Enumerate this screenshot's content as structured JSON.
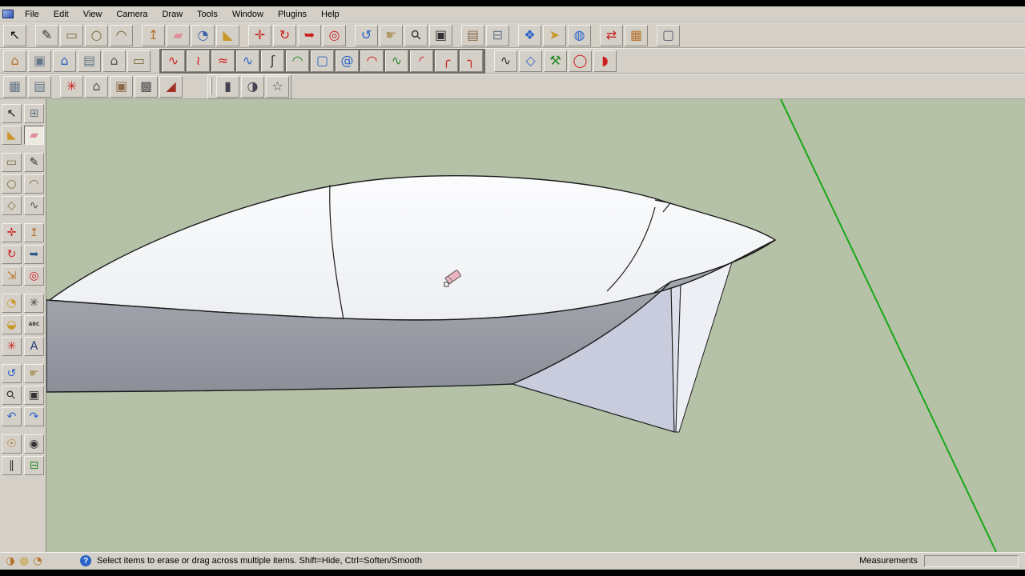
{
  "menu": {
    "items": [
      {
        "label": "File"
      },
      {
        "label": "Edit"
      },
      {
        "label": "View"
      },
      {
        "label": "Camera"
      },
      {
        "label": "Draw"
      },
      {
        "label": "Tools"
      },
      {
        "label": "Window"
      },
      {
        "label": "Plugins"
      },
      {
        "label": "Help"
      }
    ]
  },
  "toolbar_main": {
    "items": [
      {
        "name": "select-tool",
        "glyph": "↖",
        "color": "#111111"
      },
      {
        "name": "line-tool",
        "glyph": "✎",
        "color": "#333333",
        "gap": true
      },
      {
        "name": "rectangle-tool",
        "glyph": "▭",
        "color": "#7a6a3a"
      },
      {
        "name": "circle-tool",
        "glyph": "○",
        "color": "#7a6a3a"
      },
      {
        "name": "arc-tool",
        "glyph": "◠",
        "color": "#7a6a3a"
      },
      {
        "name": "pushpull-tool",
        "glyph": "↥",
        "color": "#b5722a",
        "gap": true
      },
      {
        "name": "eraser-tool",
        "glyph": "▰",
        "color": "#de8f9e"
      },
      {
        "name": "tape-measure-tool",
        "glyph": "◔",
        "color": "#3a62a8"
      },
      {
        "name": "paint-bucket-tool",
        "glyph": "◣",
        "color": "#c8962a"
      },
      {
        "name": "move-tool",
        "glyph": "✛",
        "color": "#cc2020",
        "gap": true
      },
      {
        "name": "rotate-tool",
        "glyph": "↻",
        "color": "#cc2020"
      },
      {
        "name": "follow-me-tool",
        "glyph": "➥",
        "color": "#cc2020"
      },
      {
        "name": "offset-tool",
        "glyph": "◎",
        "color": "#cc2020"
      },
      {
        "name": "orbit-tool",
        "glyph": "↺",
        "color": "#2a62c8",
        "gap": true
      },
      {
        "name": "pan-tool",
        "glyph": "☛",
        "color": "#b09a6a"
      },
      {
        "name": "zoom-tool",
        "glyph": "⚲",
        "color": "#333333",
        "rot": true
      },
      {
        "name": "zoom-window-tool",
        "glyph": "▣",
        "color": "#333333"
      },
      {
        "name": "get-models-tool",
        "glyph": "▤",
        "color": "#8a6a4a",
        "gap": true
      },
      {
        "name": "section-plane-tool",
        "glyph": "⊟",
        "color": "#667788"
      },
      {
        "name": "components-tool",
        "glyph": "❖",
        "color": "#2a62c8",
        "gap": true
      },
      {
        "name": "interact-tool",
        "glyph": "➤",
        "color": "#c8962a"
      },
      {
        "name": "add-location-tool",
        "glyph": "◍",
        "color": "#2a62c8"
      },
      {
        "name": "exchange-tool",
        "glyph": "⇄",
        "color": "#cc2020",
        "gap": true
      },
      {
        "name": "materials-tool",
        "glyph": "▦",
        "color": "#b5722a"
      },
      {
        "name": "box-tool",
        "glyph": "▢",
        "color": "#555566",
        "gap": true
      }
    ]
  },
  "toolbar_views": {
    "items": [
      {
        "name": "iso-view",
        "glyph": "⌂",
        "color": "#b5722a"
      },
      {
        "name": "top-view",
        "glyph": "▣",
        "color": "#667788"
      },
      {
        "name": "home-view",
        "glyph": "⌂",
        "color": "#2a62c8"
      },
      {
        "name": "section-view",
        "glyph": "▤",
        "color": "#667788"
      },
      {
        "name": "front-view",
        "glyph": "⌂",
        "color": "#555555"
      },
      {
        "name": "plan-view",
        "glyph": "▭",
        "color": "#7a6a3a"
      }
    ]
  },
  "toolbar_curves": {
    "items": [
      {
        "name": "bezier-curve",
        "glyph": "∿",
        "color": "#cc2020"
      },
      {
        "name": "bezier-polyline",
        "glyph": "≀",
        "color": "#cc2020"
      },
      {
        "name": "bezier-multi",
        "glyph": "≈",
        "color": "#cc2020"
      },
      {
        "name": "spline",
        "glyph": "∿",
        "color": "#2a62c8"
      },
      {
        "name": "s-curve",
        "glyph": "ʃ",
        "color": "#333333"
      },
      {
        "name": "arc-green",
        "glyph": "◠",
        "color": "#2a8a2a"
      },
      {
        "name": "rounded-rectangle",
        "glyph": "▢",
        "color": "#2a62c8"
      },
      {
        "name": "spiral",
        "glyph": "@",
        "color": "#2a62c8"
      },
      {
        "name": "arc-red",
        "glyph": "◠",
        "color": "#cc2020"
      },
      {
        "name": "curve-green",
        "glyph": "∿",
        "color": "#2a8a2a"
      },
      {
        "name": "quarter-arc",
        "glyph": "◜",
        "color": "#cc2020"
      },
      {
        "name": "corner-arc-left",
        "glyph": "╭",
        "color": "#cc2020"
      },
      {
        "name": "corner-arc-right",
        "glyph": "╮",
        "color": "#cc2020"
      }
    ]
  },
  "toolbar_extra": {
    "items": [
      {
        "name": "curve-n",
        "glyph": "∿",
        "color": "#333333"
      },
      {
        "name": "polygon-tool",
        "glyph": "◇",
        "color": "#2a62c8"
      },
      {
        "name": "wrench-tool",
        "glyph": "⚒",
        "color": "#2a8a2a"
      },
      {
        "name": "ellipse-tool",
        "glyph": "◯",
        "color": "#cc2020"
      },
      {
        "name": "d-shape-tool",
        "glyph": "◗",
        "color": "#cc2020"
      }
    ]
  },
  "toolbar_sandbox": {
    "items": [
      {
        "name": "from-contours",
        "glyph": "▦",
        "color": "#667788"
      },
      {
        "name": "from-scratch",
        "glyph": "▤",
        "color": "#667788"
      },
      {
        "name": "smoove",
        "glyph": "✳",
        "color": "#cc2020",
        "gap": true
      },
      {
        "name": "stamp",
        "glyph": "⌂",
        "color": "#555555"
      },
      {
        "name": "drape",
        "glyph": "▣",
        "color": "#8a6a4a"
      },
      {
        "name": "add-detail",
        "glyph": "▩",
        "color": "#555555"
      },
      {
        "name": "flip-edge",
        "glyph": "◢",
        "color": "#a03020"
      }
    ]
  },
  "toolbar_shapes": {
    "items": [
      {
        "name": "cylinder-shape",
        "glyph": "▮",
        "color": "#444455"
      },
      {
        "name": "dome-shape",
        "glyph": "◑",
        "color": "#444455"
      },
      {
        "name": "star-shape",
        "glyph": "☆",
        "color": "#444455"
      }
    ]
  },
  "sidebar": {
    "items": [
      {
        "name": "select-tool",
        "glyph": "↖",
        "color": "#111111"
      },
      {
        "name": "make-component-tool",
        "glyph": "⊞",
        "color": "#667788"
      },
      {
        "name": "paint-bucket-tool",
        "glyph": "◣",
        "color": "#c8962a"
      },
      {
        "name": "eraser-tool",
        "glyph": "▰",
        "color": "#de8f9e",
        "active": true
      },
      {
        "name": "rectangle-tool",
        "glyph": "▭",
        "color": "#7a6a3a",
        "gap": true
      },
      {
        "name": "line-tool",
        "glyph": "✎",
        "color": "#333333",
        "gap": true
      },
      {
        "name": "circle-tool",
        "glyph": "○",
        "color": "#7a6a3a"
      },
      {
        "name": "arc-tool",
        "glyph": "◠",
        "color": "#7a6a3a"
      },
      {
        "name": "polygon-tool",
        "glyph": "◇",
        "color": "#7a6a3a"
      },
      {
        "name": "freehand-tool",
        "glyph": "∿",
        "color": "#555555"
      },
      {
        "name": "move-tool",
        "glyph": "✛",
        "color": "#cc2020",
        "gap": true
      },
      {
        "name": "pushpull-tool",
        "glyph": "↥",
        "color": "#b5722a",
        "gap": true
      },
      {
        "name": "rotate-tool",
        "glyph": "↻",
        "color": "#cc2020"
      },
      {
        "name": "follow-me-tool",
        "glyph": "➥",
        "color": "#2a5c8a"
      },
      {
        "name": "scale-tool",
        "glyph": "⇲",
        "color": "#b5722a"
      },
      {
        "name": "offset-tool",
        "glyph": "◎",
        "color": "#cc2020"
      },
      {
        "name": "tape-measure-tool",
        "glyph": "◔",
        "color": "#c8962a",
        "gap": true
      },
      {
        "name": "dimension-tool",
        "glyph": "✳",
        "color": "#444444",
        "gap": true
      },
      {
        "name": "protractor-tool",
        "glyph": "◒",
        "color": "#c8962a"
      },
      {
        "name": "text-tool",
        "glyph": "ABC",
        "color": "#333333",
        "txt": true
      },
      {
        "name": "axes-tool",
        "glyph": "✳",
        "color": "#cc2020"
      },
      {
        "name": "3d-text-tool",
        "glyph": "A",
        "color": "#223a7a"
      },
      {
        "name": "orbit-tool",
        "glyph": "↺",
        "color": "#2a62c8",
        "gap": true
      },
      {
        "name": "pan-tool",
        "glyph": "☛",
        "color": "#b09a6a",
        "gap": true
      },
      {
        "name": "zoom-tool",
        "glyph": "⚲",
        "color": "#333333",
        "rot": true
      },
      {
        "name": "zoom-window-tool",
        "glyph": "▣",
        "color": "#333333"
      },
      {
        "name": "previous-view-tool",
        "glyph": "↶",
        "color": "#2a62c8"
      },
      {
        "name": "next-view-tool",
        "glyph": "↷",
        "color": "#2a62c8"
      },
      {
        "name": "position-camera-tool",
        "glyph": "☉",
        "color": "#b5722a",
        "gap": true
      },
      {
        "name": "look-around-tool",
        "glyph": "◉",
        "color": "#333333",
        "gap": true
      },
      {
        "name": "walk-tool",
        "glyph": "∥",
        "color": "#333333"
      },
      {
        "name": "section-plane-tool",
        "glyph": "⊟",
        "color": "#2a8a2a"
      }
    ]
  },
  "canvas": {
    "background": "#b5c2a7",
    "axis_color": "#18a818",
    "deck_color": "#f7f8fa",
    "hull_color": "#9a9ca6",
    "fin_color": "#c9ccdd"
  },
  "statusbar": {
    "nav": [
      {
        "name": "status-circle-1",
        "glyph": "◑",
        "color": "#b5722a"
      },
      {
        "name": "status-circle-2",
        "glyph": "◍",
        "color": "#c8962a"
      },
      {
        "name": "status-circle-3",
        "glyph": "◔",
        "color": "#b5722a"
      }
    ],
    "help_glyph": "?",
    "help_text": "Select items to erase or drag across multiple items. Shift=Hide, Ctrl=Soften/Smooth",
    "measurements_label": "Measurements",
    "measurements_value": ""
  }
}
